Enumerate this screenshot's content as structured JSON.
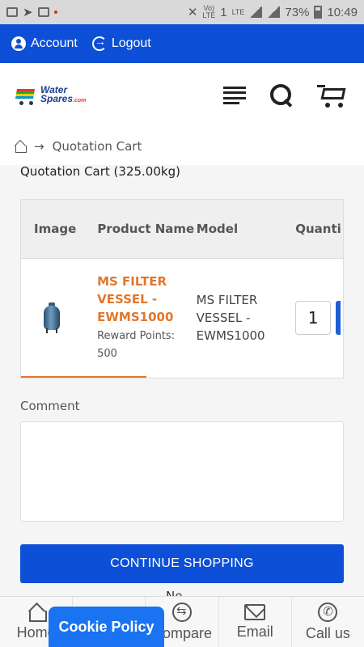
{
  "status_bar": {
    "battery": "73%",
    "time": "10:49",
    "network": "LTE",
    "sim": "1"
  },
  "topbar": {
    "account_label": "Account",
    "logout_label": "Logout"
  },
  "logo": {
    "line1": "Water",
    "line2": "Spares",
    "suffix": ".com"
  },
  "breadcrumb": {
    "arrow": "→",
    "current": "Quotation Cart"
  },
  "cart": {
    "title": "Quotation Cart  (325.00kg)",
    "columns": {
      "image": "Image",
      "product_name": "Product Name",
      "model": "Model",
      "quantity": "Quanti"
    },
    "items": [
      {
        "name": "MS FILTER VESSEL - EWMS1000",
        "reward": "Reward Points: 500",
        "model": "MS FILTER VESSEL - EWMS1000",
        "quantity": "1"
      }
    ]
  },
  "comment": {
    "label": "Comment",
    "value": ""
  },
  "continue_button": "CONTINUE SHOPPING",
  "peek_text": "Ne...",
  "bottom_nav": [
    {
      "label": "Home",
      "icon": "home-icon"
    },
    {
      "label": "",
      "icon": "heart-icon"
    },
    {
      "label": "Compare",
      "icon": "compare-icon"
    },
    {
      "label": "Email",
      "icon": "email-icon"
    },
    {
      "label": "Call us",
      "icon": "phone-icon"
    }
  ],
  "cookie_button": "Cookie Policy",
  "colors": {
    "primary": "#0d4fd6",
    "accent": "#e2762b",
    "cookie": "#1a73f0"
  }
}
